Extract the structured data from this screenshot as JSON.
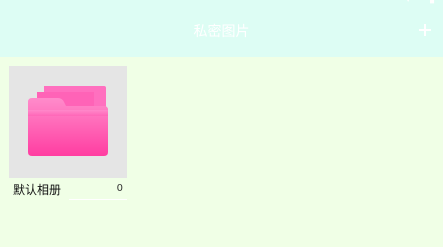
{
  "header": {
    "title": "私密图片",
    "add_icon": "plus-icon"
  },
  "albums": [
    {
      "name": "默认相册",
      "count": "0",
      "icon": "folder-icon"
    }
  ],
  "colors": {
    "header_bg": "#ddfdf4",
    "page_bg": "#f0ffe6",
    "folder_pink": "#ff4da6",
    "thumb_bg": "#e5e5e5"
  }
}
